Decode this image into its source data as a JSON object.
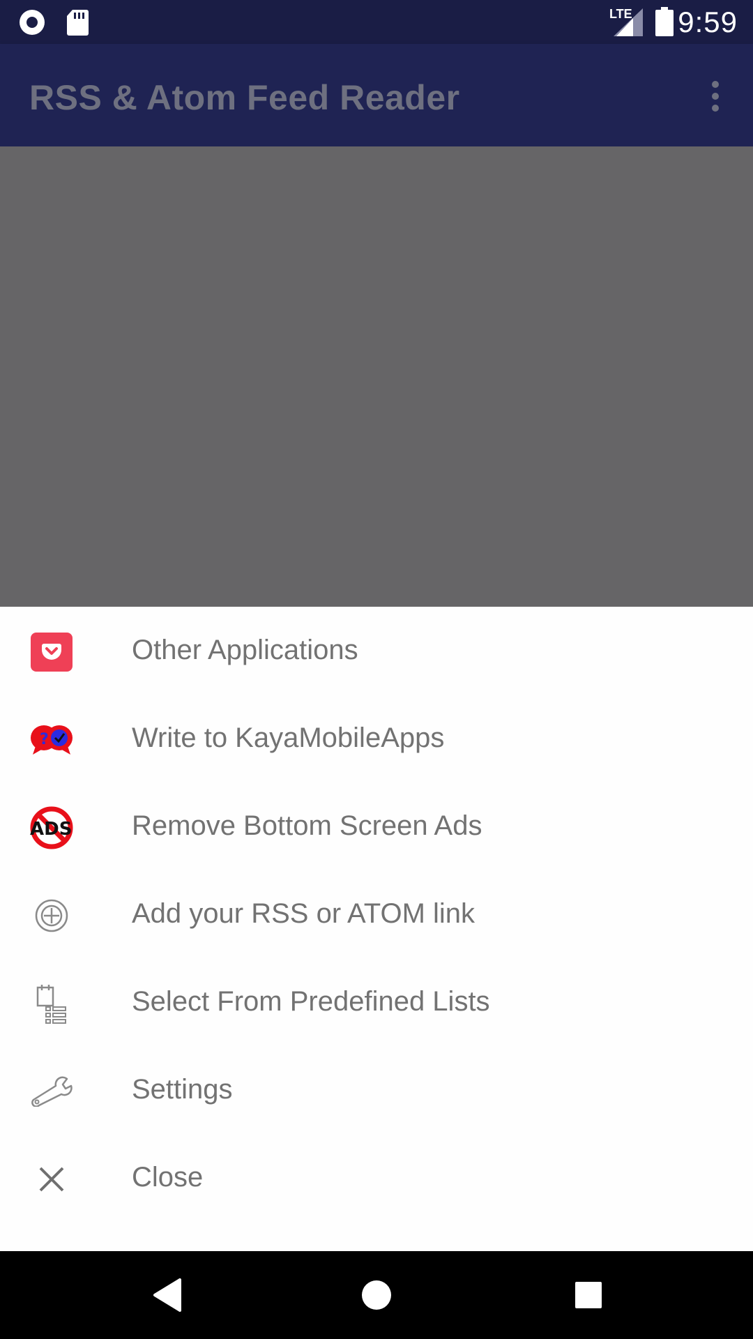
{
  "status_bar": {
    "time": "9:59",
    "network": "LTE",
    "icons": [
      "record-icon",
      "sd-card-icon",
      "signal-icon",
      "battery-icon"
    ]
  },
  "app_bar": {
    "title": "RSS & Atom Feed Reader",
    "overflow_icon": "more-vert-icon"
  },
  "menu": {
    "items": [
      {
        "label": "Other Applications",
        "icon": "pocket-icon"
      },
      {
        "label": "Write to KayaMobileApps",
        "icon": "chat-bubbles-icon"
      },
      {
        "label": "Remove Bottom Screen Ads",
        "icon": "no-ads-icon"
      },
      {
        "label": "Add your RSS or ATOM link",
        "icon": "add-circle-icon"
      },
      {
        "label": "Select From Predefined Lists",
        "icon": "list-icon"
      },
      {
        "label": "Settings",
        "icon": "wrench-icon"
      },
      {
        "label": "Close",
        "icon": "close-icon"
      }
    ],
    "ads_icon_text": "ADS"
  },
  "nav_bar": {
    "icons": [
      "back-icon",
      "home-icon",
      "recents-icon"
    ]
  },
  "colors": {
    "status_bar": "#1a1d45",
    "app_bar": "#1f2353",
    "scrim": "#666567",
    "sheet": "#fefefe",
    "label": "#727272",
    "pocket_red": "#ef4056"
  }
}
